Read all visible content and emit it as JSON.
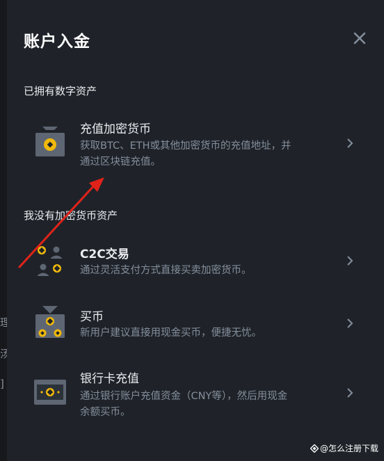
{
  "backdrop": {
    "fragments": [
      "理",
      "汤",
      "]"
    ]
  },
  "modal": {
    "title": "账户入金",
    "sections": [
      {
        "label": "已拥有数字资产"
      },
      {
        "label": "我没有加密货币资产"
      }
    ],
    "items": [
      {
        "name": "充值加密货币",
        "desc_line1": "获取BTC、ETH或其他加密货币的充值地址，并",
        "desc_line2": "通过区块链充值。",
        "icon": "crypto-deposit-icon"
      },
      {
        "name": "C2C交易",
        "desc_line1": "通过灵活支付方式直接买卖加密货币。",
        "desc_line2": "",
        "icon": "c2c-trade-icon"
      },
      {
        "name": "买币",
        "desc_line1": "新用户建议直接用现金买币，便捷无忧。",
        "desc_line2": "",
        "icon": "buy-crypto-icon"
      },
      {
        "name": "银行卡充值",
        "desc_line1": "通过银行账户充值资金（CNY等），然后用现金",
        "desc_line2": "余额买币。",
        "icon": "bank-card-icon"
      }
    ]
  },
  "watermark": {
    "text": "@怎么注册下载"
  },
  "colors": {
    "accent": "#f0b90b",
    "background": "#1f2329",
    "annotation_arrow": "#e0231a"
  }
}
